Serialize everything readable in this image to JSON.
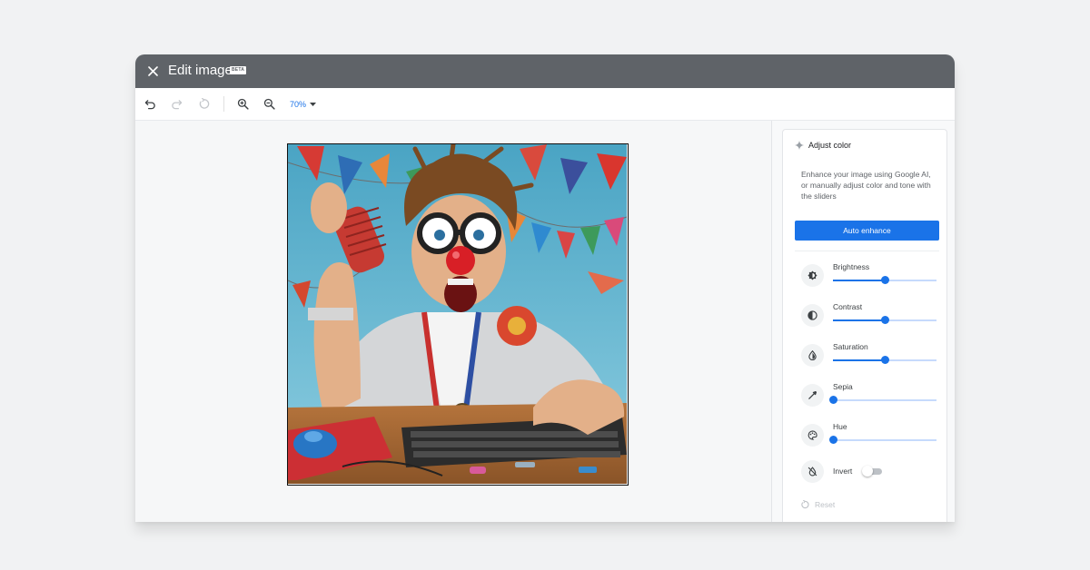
{
  "window": {
    "title": "Edit image",
    "badge": "BETA"
  },
  "toolbar": {
    "zoom_value": "70%",
    "icons": [
      "undo-icon",
      "redo-icon",
      "rotate-icon",
      "zoom-in-icon",
      "zoom-out-icon",
      "caret-down-icon"
    ]
  },
  "panel": {
    "title": "Adjust color",
    "description": "Enhance your image using Google AI, or manually adjust color and tone with the sliders",
    "auto_enhance_label": "Auto enhance",
    "adjustments": [
      {
        "label": "Brightness",
        "icon": "brightness-icon",
        "level": 0.5
      },
      {
        "label": "Contrast",
        "icon": "contrast-icon",
        "level": 0.5
      },
      {
        "label": "Saturation",
        "icon": "saturation-icon",
        "level": 0.5
      },
      {
        "label": "Sepia",
        "icon": "sepia-icon",
        "level": 0.0
      },
      {
        "label": "Hue",
        "icon": "hue-icon",
        "level": 0.0
      }
    ],
    "invert": {
      "label": "Invert",
      "icon": "invert-icon",
      "on": false
    },
    "reset_label": "Reset"
  },
  "colors": {
    "titlebar": "#5f6368",
    "accent": "#1a73e8",
    "slider_track": "#c6dafc",
    "photo_sky": "#5fb0c8"
  }
}
